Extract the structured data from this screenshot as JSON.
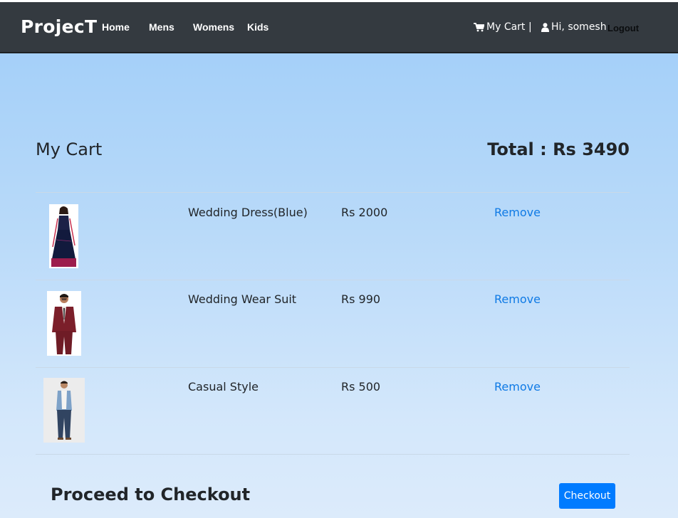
{
  "nav": {
    "brand": "ProjecT",
    "links": [
      "Home",
      "Mens",
      "Womens",
      "Kids"
    ],
    "cart_label": "My Cart",
    "cart_icon": "shopping-cart-icon",
    "separator": "|",
    "greeting": "Hi, somesh",
    "user_icon": "user-icon",
    "logout": "Logout"
  },
  "cart": {
    "title": "My Cart",
    "total": "Total : Rs 3490",
    "items": [
      {
        "name": "Wedding Dress(Blue)",
        "price": "Rs 2000",
        "remove": "Remove"
      },
      {
        "name": "Wedding Wear Suit",
        "price": "Rs 990",
        "remove": "Remove"
      },
      {
        "name": "Casual Style",
        "price": "Rs 500",
        "remove": "Remove"
      }
    ]
  },
  "checkout": {
    "title": "Proceed to Checkout",
    "button": "Checkout"
  },
  "colors": {
    "navbar": "#343a40",
    "accent": "#007bff",
    "link": "#0f7ae5"
  }
}
